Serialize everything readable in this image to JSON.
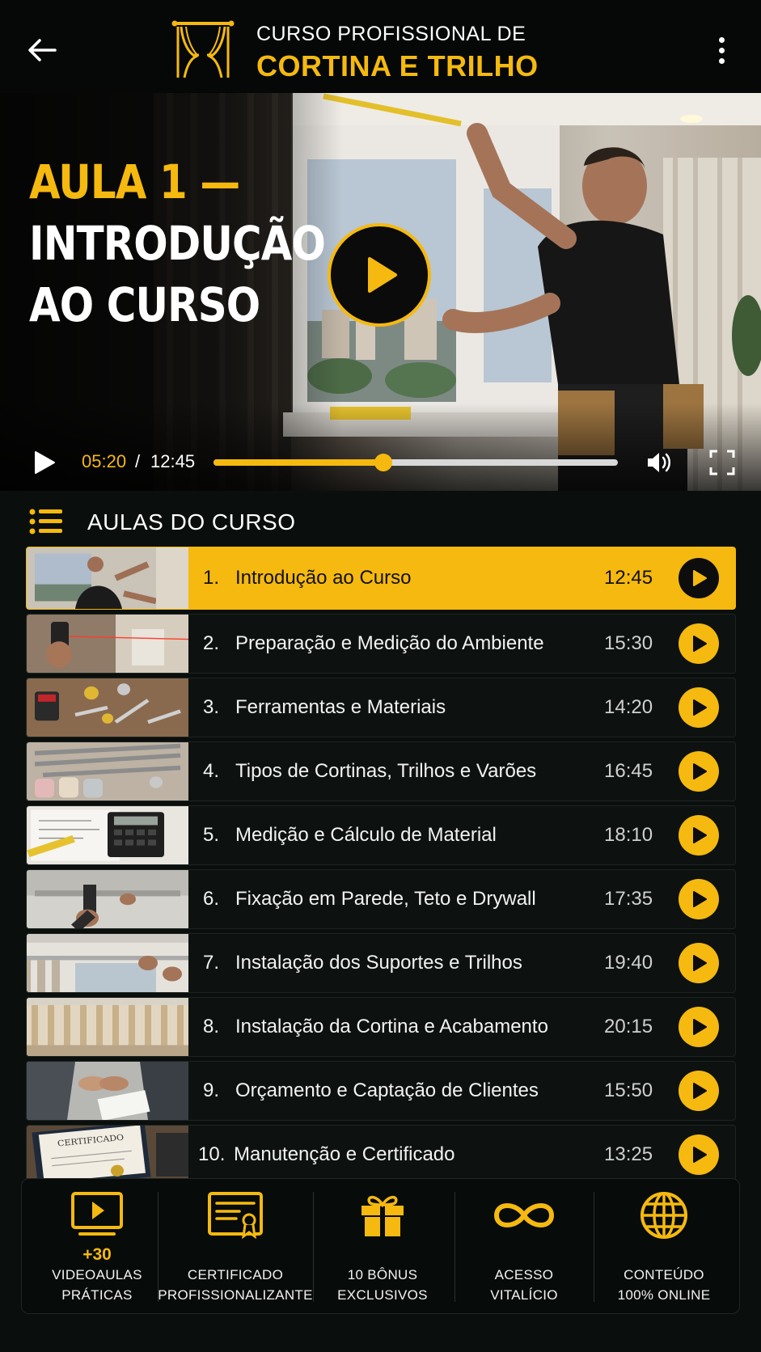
{
  "header": {
    "subtitle": "CURSO PROFISSIONAL DE",
    "title": "CORTINA E TRILHO"
  },
  "video": {
    "heading_line1": "AULA 1 —",
    "heading_line2": "INTRODUÇÃO",
    "heading_line3": "AO CURSO",
    "time_current": "05:20",
    "time_separator": "/",
    "time_total": "12:45",
    "progress_fraction": 0.42
  },
  "lessons_section": {
    "title": "AULAS DO CURSO",
    "items": [
      {
        "number": "1.",
        "label": "Introdução ao Curso",
        "duration": "12:45",
        "active": true,
        "thumb": "man-measuring-window"
      },
      {
        "number": "2.",
        "label": "Preparação e Medição do Ambiente",
        "duration": "15:30",
        "active": false,
        "thumb": "laser-measure"
      },
      {
        "number": "3.",
        "label": "Ferramentas e Materiais",
        "duration": "14:20",
        "active": false,
        "thumb": "tools-on-table"
      },
      {
        "number": "4.",
        "label": "Tipos de Cortinas, Trilhos e Varões",
        "duration": "16:45",
        "active": false,
        "thumb": "rods-and-fabrics"
      },
      {
        "number": "5.",
        "label": "Medição e Cálculo de Material",
        "duration": "18:10",
        "active": false,
        "thumb": "calculator-notebook"
      },
      {
        "number": "6.",
        "label": "Fixação em Parede, Teto e Drywall",
        "duration": "17:35",
        "active": false,
        "thumb": "drilling-ceiling"
      },
      {
        "number": "7.",
        "label": "Instalação dos Suportes e Trilhos",
        "duration": "19:40",
        "active": false,
        "thumb": "installing-rail"
      },
      {
        "number": "8.",
        "label": "Instalação da Cortina e Acabamento",
        "duration": "20:15",
        "active": false,
        "thumb": "finished-curtain"
      },
      {
        "number": "9.",
        "label": "Orçamento e Captação de Clientes",
        "duration": "15:50",
        "active": false,
        "thumb": "handshake"
      },
      {
        "number": "10.",
        "label": "Manutenção e Certificado",
        "duration": "13:25",
        "active": false,
        "thumb": "certificate"
      }
    ]
  },
  "features": [
    {
      "icon": "video-lesson-icon",
      "highlight": "+30",
      "line1": "VIDEOAULAS",
      "line2": "PRÁTICAS"
    },
    {
      "icon": "certificate-icon",
      "highlight": "",
      "line1": "CERTIFICADO",
      "line2": "PROFISSIONALIZANTE"
    },
    {
      "icon": "gift-icon",
      "highlight": "",
      "line1": "10 BÔNUS",
      "line2": "EXCLUSIVOS"
    },
    {
      "icon": "infinity-icon",
      "highlight": "",
      "line1": "ACESSO",
      "line2": "VITALÍCIO"
    },
    {
      "icon": "globe-icon",
      "highlight": "",
      "line1": "CONTEÚDO",
      "line2": "100% ONLINE"
    }
  ],
  "colors": {
    "accent": "#f5b90f",
    "background": "#0a0f0d",
    "header": "#050807"
  }
}
